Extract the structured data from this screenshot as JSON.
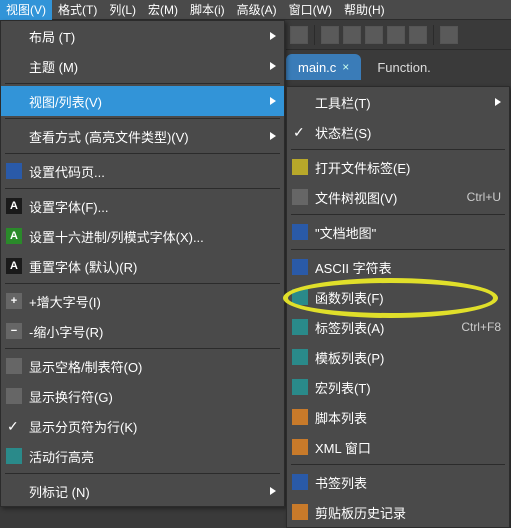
{
  "menubar": [
    {
      "label": "视图(V)",
      "active": true
    },
    {
      "label": "格式(T)"
    },
    {
      "label": "列(L)"
    },
    {
      "label": "宏(M)"
    },
    {
      "label": "脚本(i)"
    },
    {
      "label": "高级(A)"
    },
    {
      "label": "窗口(W)"
    },
    {
      "label": "帮助(H)"
    }
  ],
  "tabs": {
    "active": {
      "label": "main.c"
    },
    "inactive": {
      "label": "Function."
    }
  },
  "leftMenu": {
    "items": [
      {
        "label": "布局  (T)",
        "arrow": true
      },
      {
        "label": "主题  (M)",
        "arrow": true
      },
      {
        "sep": true
      },
      {
        "label": "视图/列表(V)",
        "arrow": true,
        "highlight": true
      },
      {
        "sep": true
      },
      {
        "label": "查看方式 (高亮文件类型)(V)",
        "arrow": true
      },
      {
        "sep": true
      },
      {
        "label": "设置代码页...",
        "icon": "code-page-icon",
        "iconCls": "ic-blue"
      },
      {
        "sep": true
      },
      {
        "label": "设置字体(F)...",
        "icon": "font-icon",
        "iconCls": "ic-a",
        "iconText": "A"
      },
      {
        "label": "设置十六进制/列模式字体(X)...",
        "icon": "font-hex-icon",
        "iconCls": "ic-a ic-ag",
        "iconText": "A"
      },
      {
        "label": "重置字体 (默认)(R)",
        "icon": "font-reset-icon",
        "iconCls": "ic-a",
        "iconText": "A"
      },
      {
        "sep": true
      },
      {
        "label": "+增大字号(I)",
        "icon": "zoom-in-icon",
        "iconText": "+",
        "iconCls": "ic-gr ic-plus"
      },
      {
        "label": "-缩小字号(R)",
        "icon": "zoom-out-icon",
        "iconText": "−",
        "iconCls": "ic-gr ic-minus"
      },
      {
        "sep": true
      },
      {
        "label": "显示空格/制表符(O)",
        "icon": "whitespace-icon",
        "iconCls": "ic-gr"
      },
      {
        "label": "显示换行符(G)",
        "icon": "eol-icon",
        "iconCls": "ic-gr"
      },
      {
        "label": "显示分页符为行(K)",
        "checked": true
      },
      {
        "label": "活动行高亮",
        "icon": "active-line-icon",
        "iconCls": "ic-teal"
      },
      {
        "sep": true
      },
      {
        "label": "列标记  (N)",
        "arrow": true
      }
    ]
  },
  "rightMenu": {
    "items": [
      {
        "label": "工具栏(T)",
        "arrow": true
      },
      {
        "label": "状态栏(S)",
        "checked": true
      },
      {
        "sep": true
      },
      {
        "label": "打开文件标签(E)",
        "icon": "file-tabs-icon",
        "iconCls": "ic-y"
      },
      {
        "label": "文件树视图(V)",
        "shortcut": "Ctrl+U",
        "icon": "tree-view-icon",
        "iconCls": "ic-gr"
      },
      {
        "sep": true
      },
      {
        "label": "\"文档地图\"",
        "icon": "doc-map-icon",
        "iconCls": "ic-blue"
      },
      {
        "sep": true
      },
      {
        "label": "ASCII 字符表",
        "icon": "ascii-table-icon",
        "iconCls": "ic-blue"
      },
      {
        "label": "函数列表(F)",
        "icon": "function-list-icon",
        "iconCls": "ic-teal",
        "ring": true
      },
      {
        "label": "标签列表(A)",
        "shortcut": "Ctrl+F8",
        "icon": "tag-list-icon",
        "iconCls": "ic-teal"
      },
      {
        "label": "模板列表(P)",
        "icon": "template-list-icon",
        "iconCls": "ic-teal"
      },
      {
        "label": "宏列表(T)",
        "icon": "macro-list-icon",
        "iconCls": "ic-teal"
      },
      {
        "label": "脚本列表",
        "icon": "script-list-icon",
        "iconCls": "ic-o"
      },
      {
        "label": "XML 窗口",
        "icon": "xml-window-icon",
        "iconCls": "ic-o"
      },
      {
        "sep": true
      },
      {
        "label": "书签列表",
        "icon": "bookmark-list-icon",
        "iconCls": "ic-blue"
      },
      {
        "label": "剪贴板历史记录",
        "icon": "clipboard-history-icon",
        "iconCls": "ic-o"
      }
    ]
  }
}
